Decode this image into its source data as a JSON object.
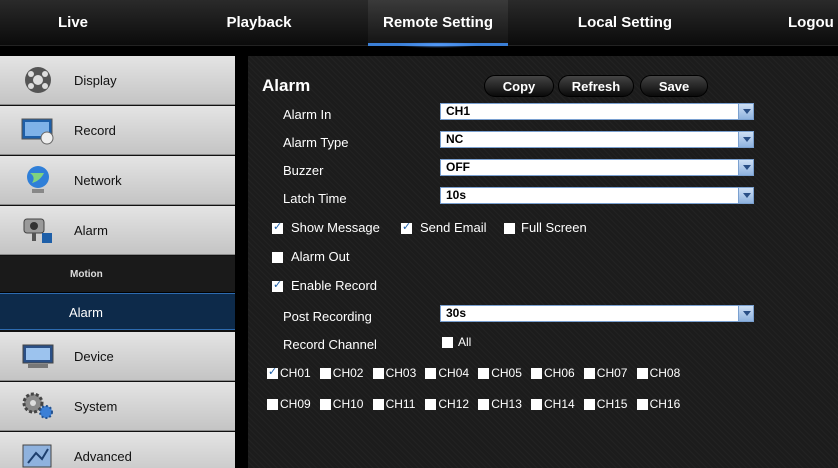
{
  "nav": {
    "live": "Live",
    "playback": "Playback",
    "remote_setting": "Remote Setting",
    "local_setting": "Local Setting",
    "logout": "Logou"
  },
  "sidebar": {
    "items": [
      {
        "label": "Display",
        "icon": "display-icon"
      },
      {
        "label": "Record",
        "icon": "record-icon"
      },
      {
        "label": "Network",
        "icon": "network-icon"
      },
      {
        "label": "Alarm",
        "icon": "alarm-icon"
      },
      {
        "label": "Device",
        "icon": "device-icon"
      },
      {
        "label": "System",
        "icon": "system-icon"
      },
      {
        "label": "Advanced",
        "icon": "advanced-icon"
      }
    ],
    "subitems": [
      {
        "label": "Motion"
      },
      {
        "label": "Alarm",
        "active": true
      }
    ]
  },
  "main": {
    "title": "Alarm",
    "buttons": {
      "copy": "Copy",
      "refresh": "Refresh",
      "save": "Save"
    },
    "fields": {
      "alarm_in": {
        "label": "Alarm In",
        "value": "CH1"
      },
      "alarm_type": {
        "label": "Alarm Type",
        "value": "NC"
      },
      "buzzer": {
        "label": "Buzzer",
        "value": "OFF"
      },
      "latch_time": {
        "label": "Latch Time",
        "value": "10s"
      },
      "post_recording": {
        "label": "Post Recording",
        "value": "30s"
      }
    },
    "options": {
      "show_message": {
        "label": "Show Message",
        "checked": true
      },
      "send_email": {
        "label": "Send Email",
        "checked": true
      },
      "full_screen": {
        "label": "Full Screen",
        "checked": false
      },
      "alarm_out": {
        "label": "Alarm Out",
        "checked": false
      },
      "enable_record": {
        "label": "Enable Record",
        "checked": true
      }
    },
    "record_channel": {
      "label": "Record Channel",
      "all_label": "All",
      "all_checked": false
    },
    "channels": [
      {
        "label": "CH01",
        "checked": true
      },
      {
        "label": "CH02",
        "checked": false
      },
      {
        "label": "CH03",
        "checked": false
      },
      {
        "label": "CH04",
        "checked": false
      },
      {
        "label": "CH05",
        "checked": false
      },
      {
        "label": "CH06",
        "checked": false
      },
      {
        "label": "CH07",
        "checked": false
      },
      {
        "label": "CH08",
        "checked": false
      },
      {
        "label": "CH09",
        "checked": false
      },
      {
        "label": "CH10",
        "checked": false
      },
      {
        "label": "CH11",
        "checked": false
      },
      {
        "label": "CH12",
        "checked": false
      },
      {
        "label": "CH13",
        "checked": false
      },
      {
        "label": "CH14",
        "checked": false
      },
      {
        "label": "CH15",
        "checked": false
      },
      {
        "label": "CH16",
        "checked": false
      }
    ]
  },
  "colors": {
    "accent": "#3b7fd6",
    "active_sub": "#0d2a4a",
    "sidebar_bg": "#d8d8d8"
  }
}
